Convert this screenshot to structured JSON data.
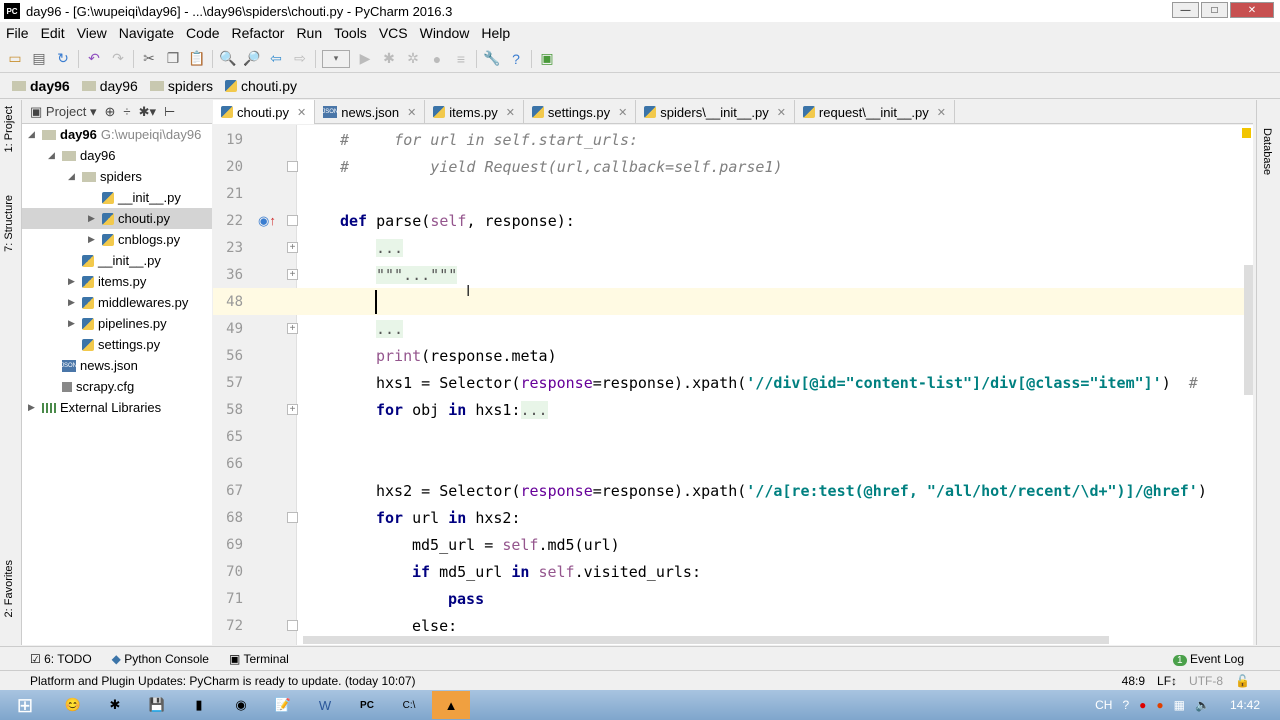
{
  "window": {
    "title": "day96 - [G:\\wupeiqi\\day96] - ...\\day96\\spiders\\chouti.py - PyCharm 2016.3",
    "logo": "PC"
  },
  "menu": [
    "File",
    "Edit",
    "View",
    "Navigate",
    "Code",
    "Refactor",
    "Run",
    "Tools",
    "VCS",
    "Window",
    "Help"
  ],
  "breadcrumb": [
    "day96",
    "day96",
    "spiders",
    "chouti.py"
  ],
  "project_panel": {
    "label": "Project",
    "tree": [
      {
        "label": "day96",
        "extra": "G:\\wupeiqi\\day96",
        "depth": 0,
        "type": "folder",
        "open": true
      },
      {
        "label": "day96",
        "depth": 1,
        "type": "folder",
        "open": true
      },
      {
        "label": "spiders",
        "depth": 2,
        "type": "folder",
        "open": true
      },
      {
        "label": "__init__.py",
        "depth": 3,
        "type": "py"
      },
      {
        "label": "chouti.py",
        "depth": 3,
        "type": "py",
        "selected": true,
        "collapsed": true
      },
      {
        "label": "cnblogs.py",
        "depth": 3,
        "type": "py",
        "collapsed": true
      },
      {
        "label": "__init__.py",
        "depth": 2,
        "type": "py"
      },
      {
        "label": "items.py",
        "depth": 2,
        "type": "py",
        "collapsed": true
      },
      {
        "label": "middlewares.py",
        "depth": 2,
        "type": "py",
        "collapsed": true
      },
      {
        "label": "pipelines.py",
        "depth": 2,
        "type": "py",
        "collapsed": true
      },
      {
        "label": "settings.py",
        "depth": 2,
        "type": "py"
      },
      {
        "label": "news.json",
        "depth": 1,
        "type": "json"
      },
      {
        "label": "scrapy.cfg",
        "depth": 1,
        "type": "cfg"
      },
      {
        "label": "External Libraries",
        "depth": 0,
        "type": "lib",
        "collapsed": true
      }
    ]
  },
  "left_tabs": [
    "1: Project",
    "7: Structure",
    "2: Favorites"
  ],
  "right_tabs": [
    "Database"
  ],
  "tabs": [
    {
      "label": "chouti.py",
      "active": true
    },
    {
      "label": "news.json"
    },
    {
      "label": "items.py"
    },
    {
      "label": "settings.py"
    },
    {
      "label": "spiders\\__init__.py"
    },
    {
      "label": "request\\__init__.py"
    }
  ],
  "editor": {
    "lines": [
      {
        "n": "19",
        "i": 0,
        "tok": [
          [
            "#     for url in self.start_urls:",
            "cm"
          ]
        ]
      },
      {
        "n": "20",
        "i": 0,
        "fold": "end",
        "tok": [
          [
            "#         yield Request(url,callback=self.parse1)",
            "cm"
          ]
        ]
      },
      {
        "n": "21",
        "i": 0,
        "tok": []
      },
      {
        "n": "22",
        "i": 0,
        "fold": "start",
        "tok": [
          [
            "def ",
            "kw"
          ],
          [
            "parse(",
            ""
          ],
          [
            "self",
            "sf"
          ],
          [
            ", response):",
            ""
          ]
        ]
      },
      {
        "n": "23",
        "i": 1,
        "fold": "plus",
        "tok": [
          [
            "...",
            "fd"
          ]
        ]
      },
      {
        "n": "36",
        "i": 1,
        "fold": "plus",
        "tok": [
          [
            "\"\"\"...\"\"\"",
            "fd"
          ]
        ]
      },
      {
        "n": "48",
        "i": 1,
        "cur": true,
        "tok": []
      },
      {
        "n": "49",
        "i": 1,
        "fold": "plus",
        "tok": [
          [
            "...",
            "fd"
          ]
        ]
      },
      {
        "n": "56",
        "i": 1,
        "tok": [
          [
            "print",
            "sf"
          ],
          [
            "(response.meta)",
            ""
          ]
        ]
      },
      {
        "n": "57",
        "i": 1,
        "tok": [
          [
            "hxs1 = Selector(",
            ""
          ],
          [
            "response",
            "pm"
          ],
          [
            "=response).xpath(",
            ""
          ],
          [
            "'//div[@id=\"content-list\"]/div[@class=\"item\"]'",
            "str"
          ],
          [
            ")  ",
            ""
          ],
          [
            "# ",
            "cm"
          ]
        ]
      },
      {
        "n": "58",
        "i": 1,
        "fold": "plus",
        "tok": [
          [
            "for ",
            "kw"
          ],
          [
            "obj ",
            ""
          ],
          [
            "in ",
            "kw"
          ],
          [
            "hxs1:",
            ""
          ],
          [
            "...",
            "fd"
          ]
        ]
      },
      {
        "n": "65",
        "i": 1,
        "tok": []
      },
      {
        "n": "66",
        "i": 1,
        "tok": []
      },
      {
        "n": "67",
        "i": 1,
        "tok": [
          [
            "hxs2 = Selector(",
            ""
          ],
          [
            "response",
            "pm"
          ],
          [
            "=response).xpath(",
            ""
          ],
          [
            "'//a[re:test(@href, \"/all/hot/recent/\\d+\")]/@href'",
            "str"
          ],
          [
            ")",
            ""
          ]
        ]
      },
      {
        "n": "68",
        "i": 1,
        "fold": "start",
        "tok": [
          [
            "for ",
            "kw"
          ],
          [
            "url ",
            ""
          ],
          [
            "in ",
            "kw"
          ],
          [
            "hxs2:",
            ""
          ]
        ]
      },
      {
        "n": "69",
        "i": 2,
        "tok": [
          [
            "md5_url = ",
            ""
          ],
          [
            "self",
            "sf"
          ],
          [
            ".md5(url)",
            ""
          ]
        ]
      },
      {
        "n": "70",
        "i": 2,
        "tok": [
          [
            "if ",
            "kw"
          ],
          [
            "md5_url ",
            ""
          ],
          [
            "in ",
            "kw"
          ],
          [
            "self",
            "sf"
          ],
          [
            ".visited_urls:",
            ""
          ]
        ]
      },
      {
        "n": "71",
        "i": 3,
        "tok": [
          [
            "pass",
            "kw"
          ]
        ]
      },
      {
        "n": "72",
        "i": 2,
        "fold": "start",
        "tok": [
          [
            "else",
            ""
          ],
          [
            ":",
            ""
          ]
        ]
      }
    ]
  },
  "bottom_tools": [
    {
      "label": "6: TODO"
    },
    {
      "label": "Python Console"
    },
    {
      "label": "Terminal"
    }
  ],
  "event_log": {
    "label": "Event Log",
    "count": "1"
  },
  "status": {
    "message": "Platform and Plugin Updates: PyCharm is ready to update. (today 10:07)",
    "position": "48:9",
    "line_sep": "LF↕",
    "encoding": "UTF-8"
  },
  "taskbar": {
    "clock": "14:42",
    "lang": "CH"
  }
}
